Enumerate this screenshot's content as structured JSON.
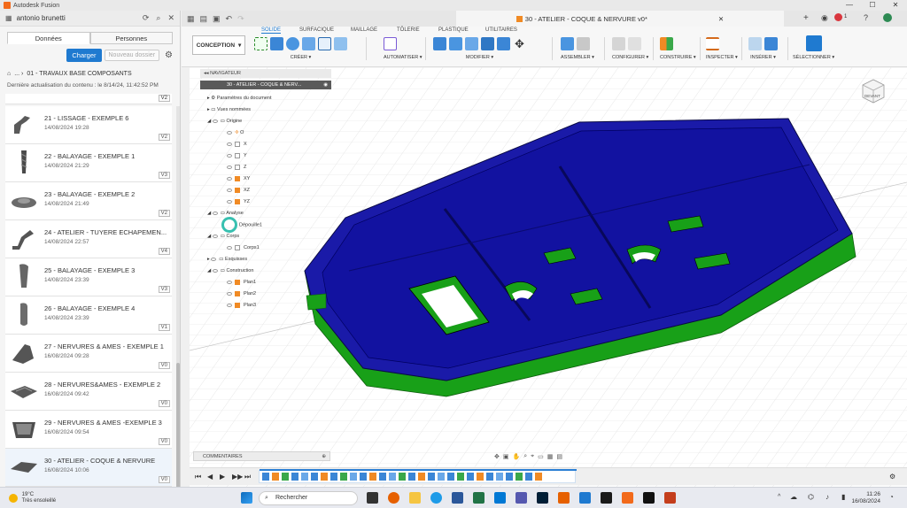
{
  "window": {
    "title": "Autodesk Fusion"
  },
  "left_panel": {
    "user": "antonio brunetti",
    "tabs": [
      "Données",
      "Personnes"
    ],
    "load_button": "Charger",
    "new_folder_button": "Nouveau dossier",
    "breadcrumb_sep": "... ›",
    "folder": "01 - TRAVAUX BASE COMPOSANTS",
    "updated": "Dernière actualisation du contenu : le 8/14/24, 11:42:52 PM",
    "top_version": "V2",
    "items": [
      {
        "name": "21 - LISSAGE - EXEMPLE 6",
        "date": "14/08/2024 19:28",
        "version": "V2"
      },
      {
        "name": "22 - BALAYAGE - EXEMPLE 1",
        "date": "14/08/2024 21:29",
        "version": "V3"
      },
      {
        "name": "23 - BALAYAGE - EXEMPLE 2",
        "date": "14/08/2024 21:49",
        "version": "V2"
      },
      {
        "name": "24 - ATELIER - TUYERE ECHAPEMEN...",
        "date": "14/08/2024 22:57",
        "version": "V4"
      },
      {
        "name": "25 - BALAYAGE - EXEMPLE 3",
        "date": "14/08/2024 23:39",
        "version": "V3"
      },
      {
        "name": "26 - BALAYAGE - EXEMPLE 4",
        "date": "14/08/2024 23:39",
        "version": "V1"
      },
      {
        "name": "27 - NERVURES & AMES - EXEMPLE 1",
        "date": "16/08/2024 09:28",
        "version": "V0"
      },
      {
        "name": "28 - NERVURES&AMES - EXEMPLE 2",
        "date": "16/08/2024 09:42",
        "version": "V0"
      },
      {
        "name": "29 - NERVURES & AMES -EXEMPLE 3",
        "date": "16/08/2024 09:54",
        "version": "V0"
      },
      {
        "name": "30 - ATELIER - COQUE & NERVURE",
        "date": "16/08/2024 10:06",
        "version": "V0"
      }
    ]
  },
  "document_tab": {
    "title": "30 - ATELIER - COQUE & NERVURE v0*"
  },
  "toolbar": {
    "workspace": "CONCEPTION",
    "tabs": [
      "SOLIDE",
      "SURFACIQUE",
      "MAILLAGE",
      "TÔLERIE",
      "PLASTIQUE",
      "UTILITAIRES"
    ],
    "groups": [
      "CRÉER",
      "AUTOMATISER",
      "MODIFIER",
      "ASSEMBLER",
      "CONFIGURER",
      "CONSTRUIRE",
      "INSPECTER",
      "INSÉRER",
      "SÉLECTIONNER"
    ],
    "notif_count": "1"
  },
  "navigator": {
    "header": "NAVIGATEUR",
    "root": "30 - ATELIER - COQUE & NERV...",
    "rows": [
      "Paramètres du document",
      "Vues nommées",
      "Origine",
      "O",
      "X",
      "Y",
      "Z",
      "XY",
      "XZ",
      "YZ",
      "Analyse",
      "Dépouille1",
      "Corps",
      "Corps1",
      "Esquisses",
      "Construction",
      "Plan1",
      "Plan2",
      "Plan3"
    ]
  },
  "viewcube": {
    "label": "DEVANT"
  },
  "comments": {
    "label": "COMMENTAIRES"
  },
  "taskbar": {
    "temp": "19°C",
    "weather": "Très ensoleillé",
    "search": "Rechercher",
    "time": "11:26",
    "date": "16/08/2024"
  },
  "colors": {
    "accent": "#1f7ad0",
    "body_top": "#1a1aa8",
    "body_side": "#18a018"
  }
}
